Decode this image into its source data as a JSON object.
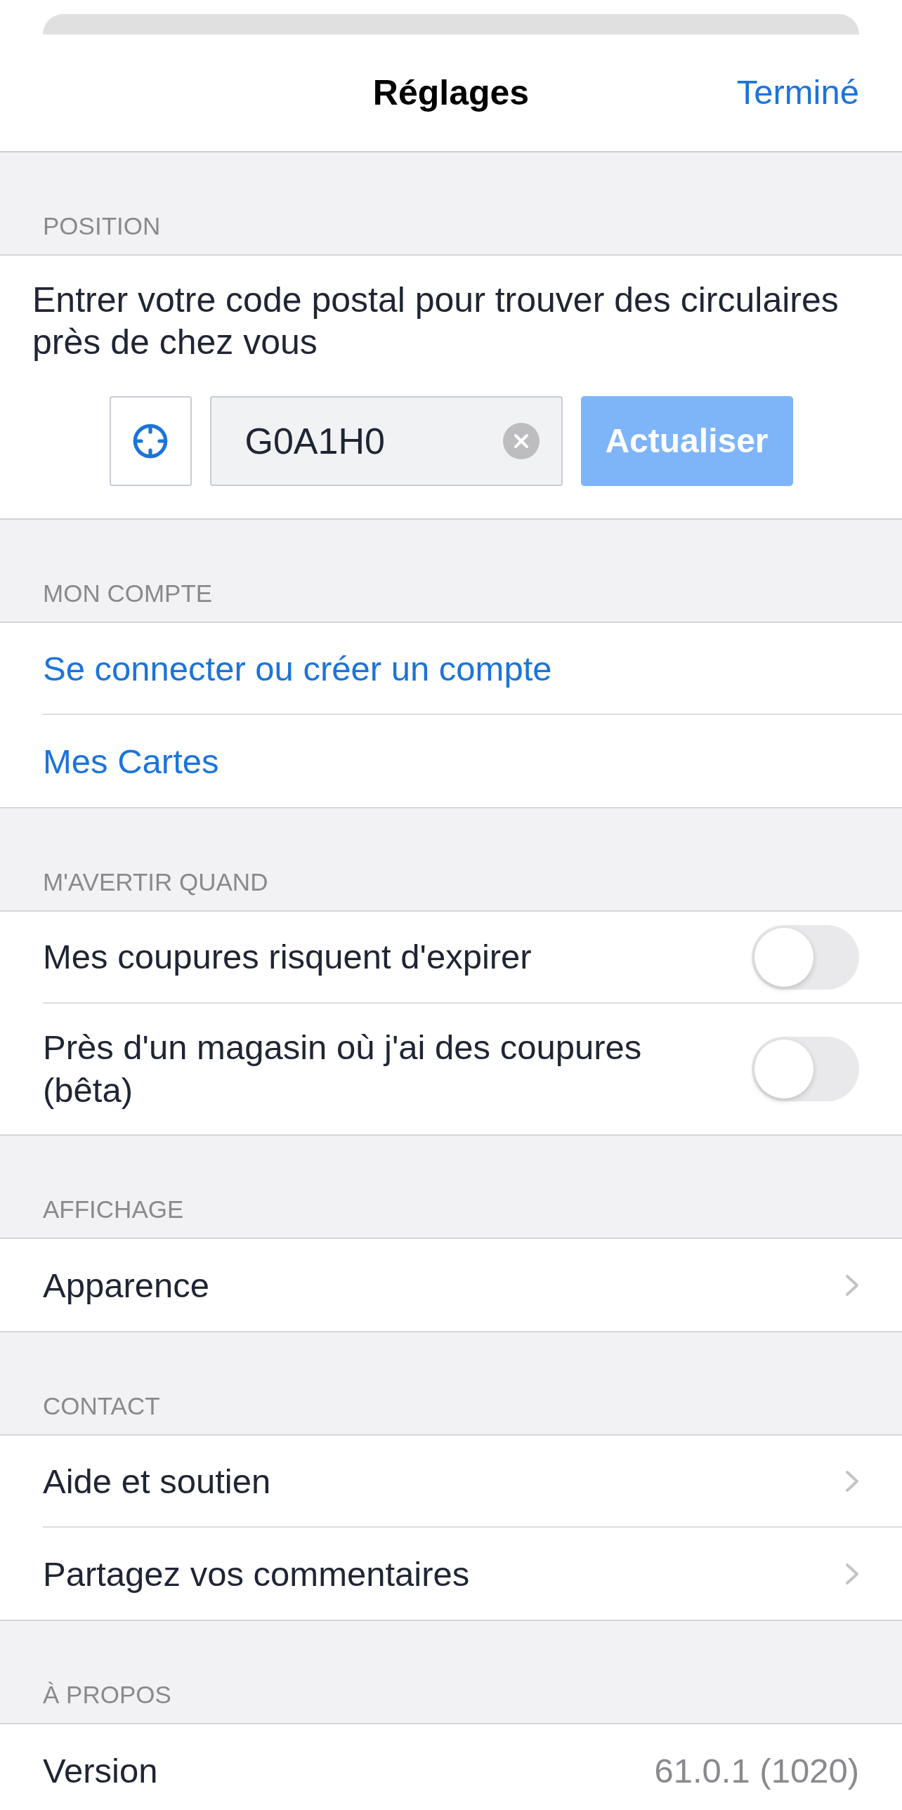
{
  "nav": {
    "title": "Réglages",
    "done": "Terminé"
  },
  "sections": [
    {
      "header": "POSITION",
      "kind": "postal_code",
      "description": "Entrer votre code postal pour trouver des circulaires près de chez vous",
      "postal_code": {
        "value": "G0A1H0"
      },
      "update_button": {
        "label": "Actualiser",
        "disabled": true
      }
    },
    {
      "header": "MON COMPTE",
      "kind": "rows",
      "rows": [
        {
          "kind": "link",
          "label": "Se connecter ou créer un compte"
        },
        {
          "kind": "link",
          "label": "Mes Cartes"
        }
      ]
    },
    {
      "header": "M'AVERTIR QUAND",
      "kind": "rows",
      "rows": [
        {
          "kind": "toggle",
          "label": "Mes coupures risquent d'expirer",
          "on": false
        },
        {
          "kind": "toggle",
          "label": "Près d'un magasin où j'ai des coupures (bêta)",
          "on": false
        }
      ]
    },
    {
      "header": "AFFICHAGE",
      "kind": "rows",
      "rows": [
        {
          "kind": "disclosure",
          "label": "Apparence"
        }
      ]
    },
    {
      "header": "CONTACT",
      "kind": "rows",
      "rows": [
        {
          "kind": "disclosure",
          "label": "Aide et soutien"
        },
        {
          "kind": "disclosure",
          "label": "Partagez vos commentaires"
        }
      ]
    },
    {
      "header": "À PROPOS",
      "kind": "rows",
      "rows": [
        {
          "kind": "value",
          "label": "Version",
          "value": "61.0.1 (1020)"
        }
      ]
    }
  ]
}
